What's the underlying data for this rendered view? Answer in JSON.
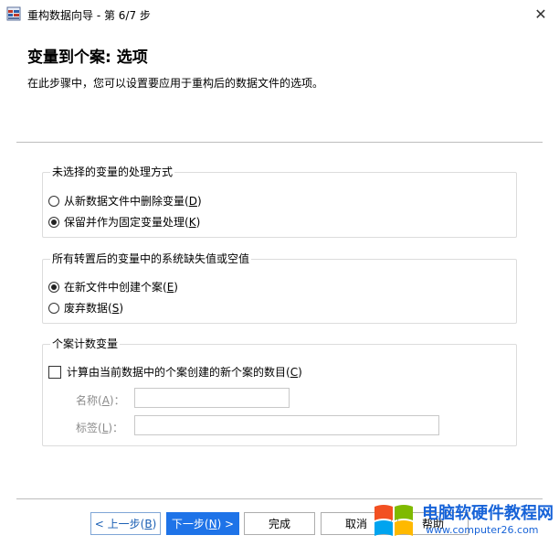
{
  "window": {
    "title": "重构数据向导 - 第 6/7 步",
    "close_glyph": "✕"
  },
  "header": {
    "title": "变量到个案: 选项",
    "description": "在此步骤中，您可以设置要应用于重构后的数据文件的选项。"
  },
  "group_unselected": {
    "legend": "未选择的变量的处理方式",
    "options": [
      {
        "label": "从新数据文件中删除变量(",
        "mnemonic": "D",
        "suffix": ")",
        "checked": false
      },
      {
        "label": "保留并作为固定变量处理(",
        "mnemonic": "K",
        "suffix": ")",
        "checked": true
      }
    ]
  },
  "group_missing": {
    "legend": "所有转置后的变量中的系统缺失值或空值",
    "options": [
      {
        "label": "在新文件中创建个案(",
        "mnemonic": "E",
        "suffix": ")",
        "checked": true
      },
      {
        "label": "废弃数据(",
        "mnemonic": "S",
        "suffix": ")",
        "checked": false
      }
    ]
  },
  "group_count": {
    "legend": "个案计数变量",
    "checkbox_label": "计算由当前数据中的个案创建的新个案的数目(",
    "checkbox_mnemonic": "C",
    "checkbox_suffix": ")",
    "checked": false,
    "name_label": "名称(",
    "name_mnemonic": "A",
    "name_suffix": ")：",
    "name_value": "",
    "tag_label": "标签(",
    "tag_mnemonic": "L",
    "tag_suffix": ")：",
    "tag_value": ""
  },
  "buttons": {
    "back_prefix": "< 上一步(",
    "back_mnemonic": "B",
    "back_suffix": ")",
    "next_prefix": "下一步(",
    "next_mnemonic": "N",
    "next_suffix": ") >",
    "finish": "完成",
    "cancel": "取消",
    "help": "帮助"
  },
  "watermark": {
    "title": "电脑软硬件教程网",
    "url": "www.computer26.com"
  },
  "colors": {
    "accent": "#1e73e8",
    "link": "#1a5fb4",
    "watermark": "#1763d8"
  }
}
